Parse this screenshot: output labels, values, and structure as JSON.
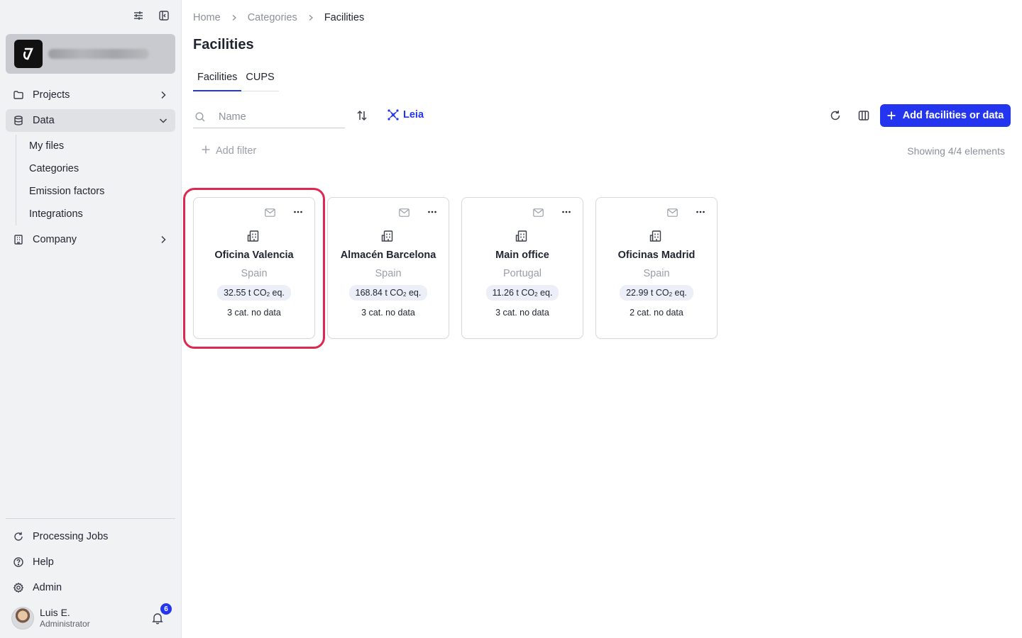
{
  "sidebar": {
    "nav": [
      {
        "label": "Projects",
        "icon": "folder-icon",
        "expanded": false
      },
      {
        "label": "Data",
        "icon": "database-icon",
        "expanded": true,
        "active": true
      },
      {
        "label": "Company",
        "icon": "building-icon",
        "expanded": false
      }
    ],
    "data_subitems": [
      "My files",
      "Categories",
      "Emission factors",
      "Integrations"
    ],
    "bottom": [
      {
        "label": "Processing Jobs",
        "icon": "refresh-icon"
      },
      {
        "label": "Help",
        "icon": "help-circle-icon"
      },
      {
        "label": "Admin",
        "icon": "gear-icon"
      }
    ],
    "user": {
      "name": "Luis E.",
      "role": "Administrator",
      "notifications": "6"
    }
  },
  "breadcrumb": [
    "Home",
    "Categories",
    "Facilities"
  ],
  "page_title": "Facilities",
  "tabs": [
    {
      "label": "Facilities",
      "active": true
    },
    {
      "label": "CUPS",
      "active": false
    }
  ],
  "toolbar": {
    "search_placeholder": "Name",
    "leia_label": "Leia",
    "add_label": "Add facilities or data",
    "add_filter_label": "Add filter",
    "showing_label": "Showing 4/4 elements"
  },
  "facilities": [
    {
      "name": "Oficina Valencia",
      "country": "Spain",
      "emissions": "32.55",
      "unit_prefix": "t CO",
      "unit_sub": "2",
      "unit_suffix": " eq.",
      "no_data": "3 cat. no data",
      "highlighted": true
    },
    {
      "name": "Almacén Barcelona",
      "country": "Spain",
      "emissions": "168.84",
      "unit_prefix": "t CO",
      "unit_sub": "2",
      "unit_suffix": " eq.",
      "no_data": "3 cat. no data",
      "highlighted": false
    },
    {
      "name": "Main office",
      "country": "Portugal",
      "emissions": "11.26",
      "unit_prefix": "t CO",
      "unit_sub": "2",
      "unit_suffix": " eq.",
      "no_data": "3 cat. no data",
      "highlighted": false
    },
    {
      "name": "Oficinas Madrid",
      "country": "Spain",
      "emissions": "22.99",
      "unit_prefix": "t CO",
      "unit_sub": "2",
      "unit_suffix": " eq.",
      "no_data": "2 cat. no data",
      "highlighted": false
    }
  ],
  "colors": {
    "accent": "#2335ef",
    "highlight": "#e0274f",
    "sidebar_bg": "#f1f2f4"
  }
}
